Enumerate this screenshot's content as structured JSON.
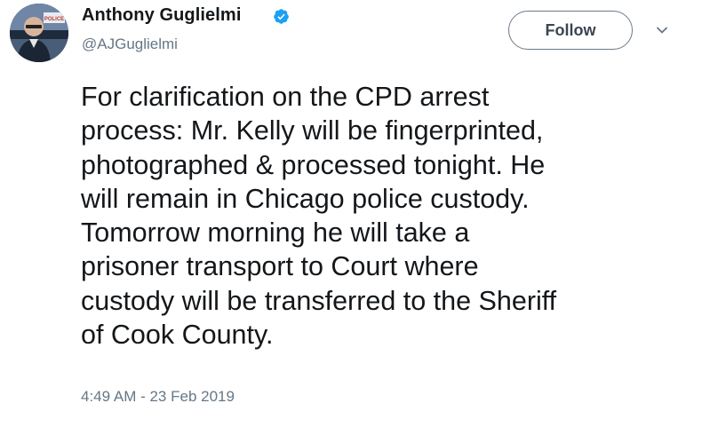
{
  "author": {
    "name": "Anthony Guglielmi",
    "handle": "@AJGuglielmi",
    "verified": true,
    "avatar_badge_text": "POLICE"
  },
  "actions": {
    "follow_label": "Follow",
    "more_icon": "chevron-down-icon"
  },
  "tweet": {
    "lines": [
      "For clarification on the CPD arrest",
      "process: Mr. Kelly will be fingerprinted,",
      "photographed & processed tonight. He",
      "will remain in Chicago police custody.",
      "Tomorrow morning he will take a",
      "prisoner transport to Court where",
      "custody will be transferred to the Sheriff",
      "of Cook County."
    ],
    "timestamp": "4:49 AM - 23 Feb 2019"
  },
  "colors": {
    "verified_blue": "#1da1f2",
    "secondary_text": "#657786",
    "primary_text": "#14171a"
  }
}
